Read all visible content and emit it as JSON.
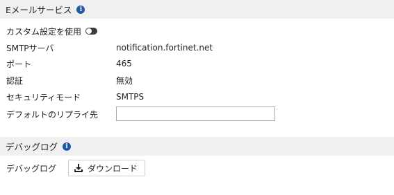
{
  "email_service": {
    "header": "Eメールサービス",
    "custom_settings_label": "カスタム設定を使用",
    "custom_settings_enabled": false,
    "fields": [
      {
        "label": "SMTPサーバ",
        "value": "notification.fortinet.net"
      },
      {
        "label": "ポート",
        "value": "465"
      },
      {
        "label": "認証",
        "value": "無効"
      },
      {
        "label": "セキュリティモード",
        "value": "SMTPS"
      }
    ],
    "default_reply_to_label": "デフォルトのリプライ先",
    "default_reply_to_value": "",
    "default_reply_to_placeholder": ""
  },
  "debug_log": {
    "header": "デバッグログ",
    "row_label": "デバッグログ",
    "download_label": "ダウンロード"
  },
  "icons": {
    "info": "info-circle-icon",
    "toggle": "toggle-off-icon",
    "download": "download-icon"
  },
  "colors": {
    "info_icon": "#1f5aa6",
    "section_bg": "#f0f0f0",
    "toggle": "#3a3a3a"
  }
}
